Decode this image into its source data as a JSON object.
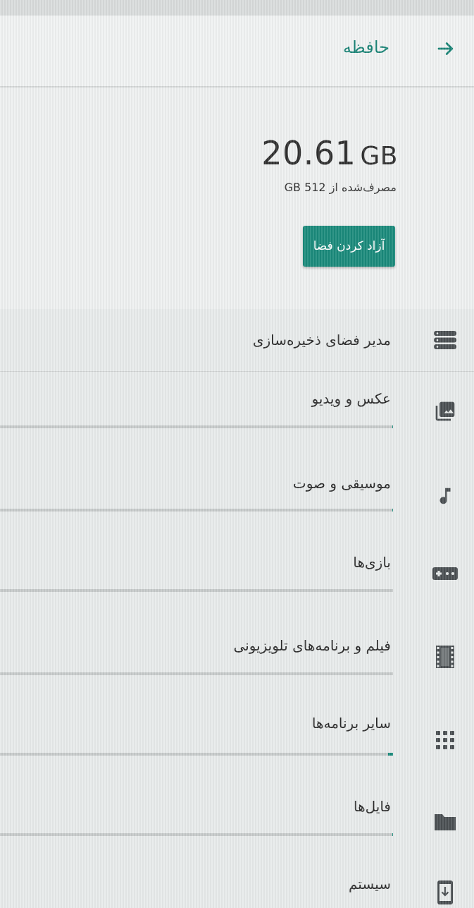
{
  "appbar": {
    "title": "حافظه",
    "back_icon": "arrow-back-icon"
  },
  "summary": {
    "used_value": "20.61",
    "used_unit": "GB",
    "used_sub": "مصرف‌شده از 512 GB",
    "free_button": "آزاد کردن فضا"
  },
  "list": {
    "storage_manager": {
      "label": "مدیر فضای ذخیره‌سازی",
      "icon": "storage-icon"
    },
    "photos": {
      "label": "عکس و ویدیو",
      "icon": "photo-library-icon",
      "usage_fraction": 0.002
    },
    "music": {
      "label": "موسیقی و صوت",
      "icon": "music-note-icon",
      "usage_fraction": 0.001
    },
    "games": {
      "label": "بازی‌ها",
      "icon": "gamepad-icon",
      "usage_fraction": 0.0
    },
    "movies": {
      "label": "فیلم و برنامه‌های تلویزیونی",
      "icon": "movie-icon",
      "usage_fraction": 0.0
    },
    "other_apps": {
      "label": "سایر برنامه‌ها",
      "icon": "apps-grid-icon",
      "usage_fraction": 0.012
    },
    "files": {
      "label": "فایل‌ها",
      "icon": "folder-icon",
      "usage_fraction": 0.001
    },
    "system": {
      "label": "سیستم",
      "icon": "system-update-icon"
    }
  },
  "colors": {
    "accent": "#1a8a7b",
    "title": "#1b8577",
    "icon": "#4a4f52",
    "bar_track": "#c6caca"
  }
}
